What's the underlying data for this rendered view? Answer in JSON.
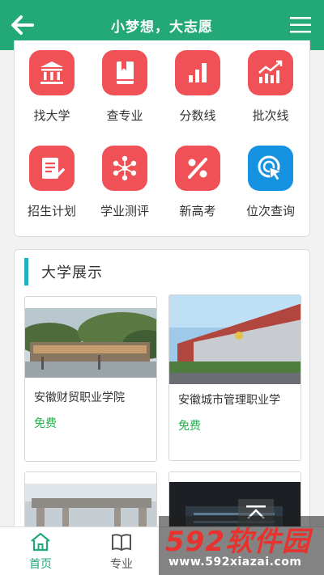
{
  "header": {
    "title": "小梦想，大志愿"
  },
  "functions": [
    {
      "label": "找大学",
      "icon": "university-building-icon",
      "color": "#ef5157"
    },
    {
      "label": "查专业",
      "icon": "book-icon",
      "color": "#ef5157"
    },
    {
      "label": "分数线",
      "icon": "bar-chart-icon",
      "color": "#ef5157"
    },
    {
      "label": "批次线",
      "icon": "trend-chart-icon",
      "color": "#ef5157"
    },
    {
      "label": "招生计划",
      "icon": "plan-document-icon",
      "color": "#ef5157"
    },
    {
      "label": "学业测评",
      "icon": "molecule-network-icon",
      "color": "#ef5157"
    },
    {
      "label": "新高考",
      "icon": "percent-icon",
      "color": "#ef5157"
    },
    {
      "label": "位次查询",
      "icon": "target-cursor-icon",
      "color": "#1592e0"
    }
  ],
  "university_section": {
    "title": "大学展示",
    "items": [
      {
        "name": "安徽财贸职业学院",
        "price": "免费"
      },
      {
        "name": "安徽城市管理职业学",
        "price": "免费"
      },
      {
        "name": "",
        "price": ""
      },
      {
        "name": "",
        "price": ""
      }
    ]
  },
  "bottom_nav": {
    "tabs": [
      {
        "label": "首页",
        "icon": "home-icon"
      },
      {
        "label": "专业",
        "icon": "open-book-icon"
      }
    ]
  },
  "watermark": {
    "main_number": "592",
    "main_text": "软件园",
    "url": "www.592xiazai.com"
  },
  "colors": {
    "accent": "#23a878",
    "icon_red": "#ef5157",
    "icon_blue": "#1592e0",
    "free": "#24b14d",
    "section_bar": "#22b0c0"
  }
}
